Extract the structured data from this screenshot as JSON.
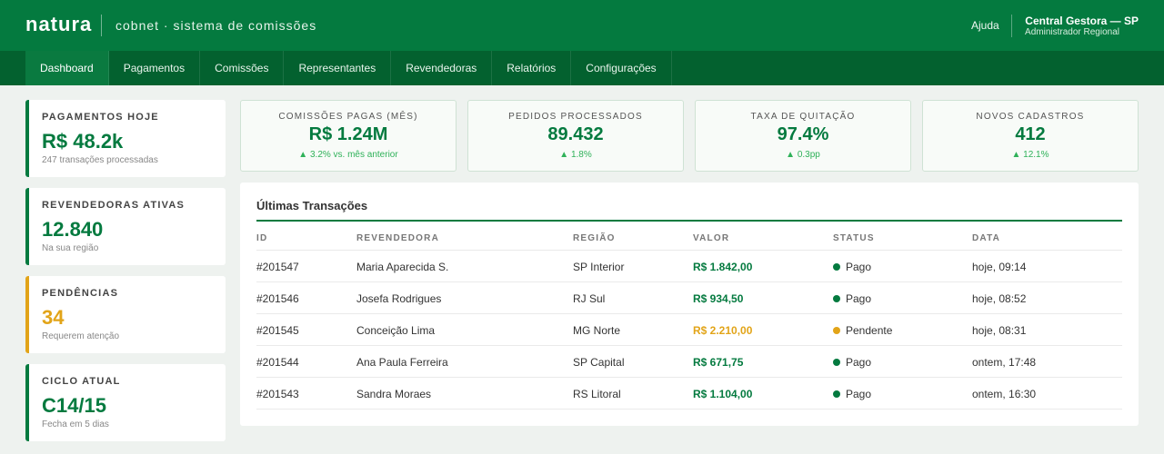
{
  "header": {
    "brand": "natura",
    "subtitle": "cobnet · sistema de comissões",
    "help": "Ajuda",
    "user_name": "Central Gestora — SP",
    "user_role": "Administrador Regional"
  },
  "nav": {
    "items": [
      "Dashboard",
      "Pagamentos",
      "Comissões",
      "Representantes",
      "Revendedoras",
      "Relatórios",
      "Configurações"
    ],
    "active": "Dashboard"
  },
  "sidebar": [
    {
      "label": "PAGAMENTOS HOJE",
      "value": "R$ 48.2k",
      "desc": "247 transações processadas"
    },
    {
      "label": "REVENDEDORAS ATIVAS",
      "value": "12.840",
      "desc": "Na sua região"
    },
    {
      "label": "PENDÊNCIAS",
      "value": "34",
      "desc": "Requerem atenção"
    },
    {
      "label": "CICLO ATUAL",
      "value": "C14/15",
      "desc": "Fecha em 5 dias"
    }
  ],
  "kpis": [
    {
      "label": "COMISSÕES PAGAS (MÊS)",
      "value": "R$ 1.24M",
      "delta": "▲ 3.2% vs. mês anterior"
    },
    {
      "label": "PEDIDOS PROCESSADOS",
      "value": "89.432",
      "delta": "▲ 1.8%"
    },
    {
      "label": "TAXA DE QUITAÇÃO",
      "value": "97.4%",
      "delta": "▲ 0.3pp"
    },
    {
      "label": "NOVOS CADASTROS",
      "value": "412",
      "delta": "▲ 12.1%"
    }
  ],
  "transactions": {
    "title": "Últimas Transações",
    "columns": [
      "ID",
      "REVENDEDORA",
      "REGIÃO",
      "VALOR",
      "STATUS",
      "DATA"
    ],
    "rows": [
      {
        "id": "#201547",
        "name": "Maria Aparecida S.",
        "region": "SP Interior",
        "value": "R$ 1.842,00",
        "status": "Pago",
        "date": "hoje, 09:14"
      },
      {
        "id": "#201546",
        "name": "Josefa Rodrigues",
        "region": "RJ Sul",
        "value": "R$ 934,50",
        "status": "Pago",
        "date": "hoje, 08:52"
      },
      {
        "id": "#201545",
        "name": "Conceição Lima",
        "region": "MG Norte",
        "value": "R$ 2.210,00",
        "status": "Pendente",
        "date": "hoje, 08:31"
      },
      {
        "id": "#201544",
        "name": "Ana Paula Ferreira",
        "region": "SP Capital",
        "value": "R$ 671,75",
        "status": "Pago",
        "date": "ontem, 17:48"
      },
      {
        "id": "#201543",
        "name": "Sandra Moraes",
        "region": "RS Litoral",
        "value": "R$ 1.104,00",
        "status": "Pago",
        "date": "ontem, 16:30"
      }
    ]
  },
  "colors": {
    "primary": "#047a3f",
    "nav": "#03612f",
    "warning": "#e2a418",
    "positive": "#2fb159"
  }
}
